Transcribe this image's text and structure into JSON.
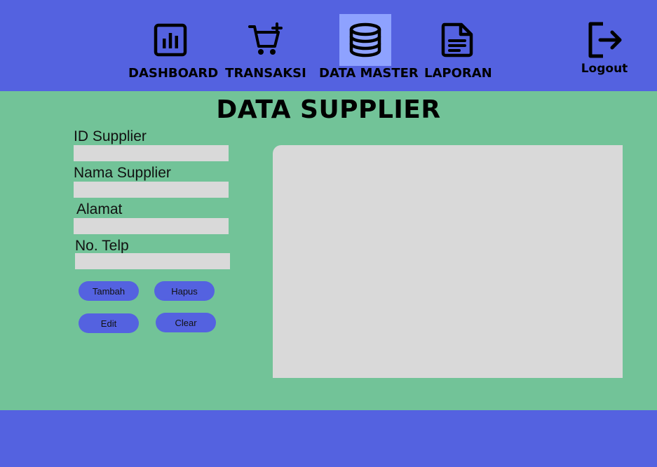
{
  "nav": {
    "items": [
      {
        "label": "DASHBOARD",
        "icon": "chart-icon",
        "active": false
      },
      {
        "label": "TRANSAKSI",
        "icon": "cart-add-icon",
        "active": false
      },
      {
        "label": "DATA MASTER",
        "icon": "database-icon",
        "active": true
      },
      {
        "label": "LAPORAN",
        "icon": "document-icon",
        "active": false
      }
    ],
    "logout": {
      "label": "Logout",
      "icon": "logout-icon"
    }
  },
  "page": {
    "title": "DATA SUPPLIER"
  },
  "form": {
    "fields": [
      {
        "label": "ID Supplier",
        "value": ""
      },
      {
        "label": "Nama Supplier",
        "value": ""
      },
      {
        "label": "Alamat",
        "value": ""
      },
      {
        "label": "No. Telp",
        "value": ""
      }
    ],
    "buttons": {
      "add": "Tambah",
      "delete": "Hapus",
      "edit": "Edit",
      "clear": "Clear"
    }
  },
  "colors": {
    "header": "#5462e0",
    "background": "#72c398",
    "active_nav": "#8ea2ff",
    "panel": "#d9d9d9",
    "button": "#5462e0"
  }
}
